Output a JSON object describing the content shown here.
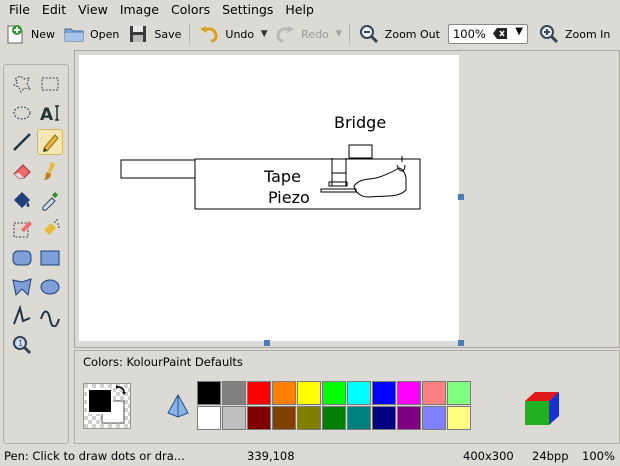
{
  "menu": [
    "File",
    "Edit",
    "View",
    "Image",
    "Colors",
    "Settings",
    "Help"
  ],
  "toolbar": {
    "new": "New",
    "open": "Open",
    "save": "Save",
    "undo": "Undo",
    "redo": "Redo",
    "zoom_out": "Zoom Out",
    "zoom_value": "100%",
    "zoom_in": "Zoom In"
  },
  "canvas": {
    "texts": [
      "Bridge",
      "Tape",
      "Piezo"
    ]
  },
  "colors": {
    "title": "Colors: KolourPaint Defaults",
    "row1": [
      "#000000",
      "#808080",
      "#ff0000",
      "#ff8000",
      "#ffff00",
      "#00ff00",
      "#00ffff",
      "#0000ff",
      "#ff00ff",
      "#ff8080",
      "#80ff80"
    ],
    "row2": [
      "#ffffff",
      "#c0c0c0",
      "#800000",
      "#804000",
      "#808000",
      "#008000",
      "#008080",
      "#000080",
      "#800080",
      "#8080ff",
      "#ffff80"
    ],
    "foreground": "#000000",
    "background": "#ffffff"
  },
  "status": {
    "message": "Pen: Click to draw dots or dra...",
    "coords": "339,108",
    "size": "400x300",
    "depth": "24bpp",
    "zoom": "100%"
  }
}
